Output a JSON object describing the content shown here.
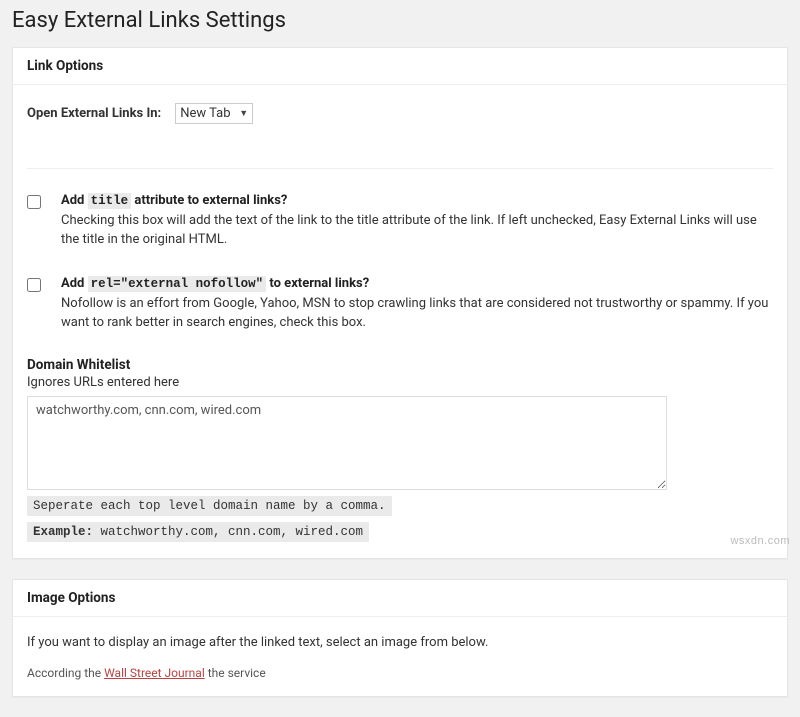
{
  "page_title": "Easy External Links Settings",
  "link_options": {
    "header": "Link Options",
    "open_in_label": "Open External Links In:",
    "open_in_value": "New Tab",
    "title_attr": {
      "heading_prefix": "Add ",
      "heading_code": "title",
      "heading_suffix": " attribute to external links?",
      "desc": "Checking this box will add the text of the link to the title attribute of the link. If left unchecked, Easy External Links will use the title in the original HTML."
    },
    "rel_attr": {
      "heading_prefix": "Add ",
      "heading_code": "rel=\"external nofollow\"",
      "heading_suffix": " to external links?",
      "desc": "Nofollow is an effort from Google, Yahoo, MSN to stop crawling links that are considered not trustworthy or spammy. If you want to rank better in search engines, check this box."
    },
    "whitelist": {
      "heading": "Domain Whitelist",
      "subtext": "Ignores URLs entered here",
      "value": "watchworthy.com, cnn.com, wired.com",
      "hint1": "Seperate each top level domain name by a comma.",
      "hint2_label": "Example:",
      "hint2_value": " watchworthy.com, cnn.com, wired.com"
    }
  },
  "image_options": {
    "header": "Image Options",
    "desc": "If you want to display an image after the linked text, select an image from below.",
    "example_prefix": "According the ",
    "example_link": "Wall Street Journal",
    "example_suffix": " the service"
  },
  "watermark": "wsxdn.com"
}
